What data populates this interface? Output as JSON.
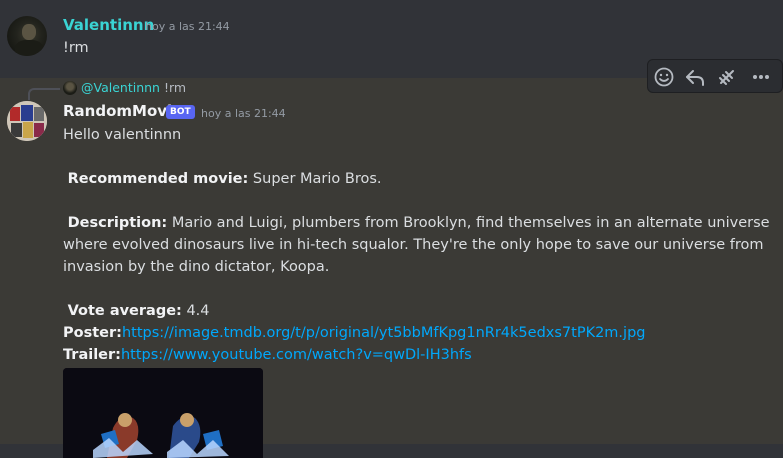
{
  "user_message": {
    "author": "Valentinnn",
    "timestamp": "hoy a las 21:44",
    "text": "!rm"
  },
  "bot_message": {
    "reply_preview": {
      "author": "@Valentinnn",
      "text": "!rm"
    },
    "author": "RandomMovie",
    "badge": "BOT",
    "timestamp": "hoy a las 21:44",
    "greeting": "Hello valentinnn",
    "recommended_label": "Recommended movie:",
    "recommended_value": "Super Mario Bros.",
    "description_label": "Description:",
    "description_lines": [
      "Mario and Luigi, plumbers from Brooklyn, find themselves in an alternate universe",
      "where evolved dinosaurs live in hi-tech squalor. They're the only hope to save our universe from",
      "invasion by the dino dictator, Koopa."
    ],
    "vote_label": "Vote average:",
    "vote_value": "4.4",
    "poster_label": "Poster:",
    "poster_url": "https://image.tmdb.org/t/p/original/yt5bbMfKpg1nRr4k5edxs7tPK2m.jpg",
    "trailer_label": "Trailer:",
    "trailer_url": "https://www.youtube.com/watch?v=qwDl-IH3hfs"
  },
  "toolbar_icons": [
    "add-reaction-icon",
    "reply-icon",
    "create-thread-icon",
    "more-icon"
  ],
  "colors": {
    "background": "#313338",
    "hover_background": "#3b3a36",
    "user_name": "#3ad4d4",
    "link": "#00a8fc",
    "bot_badge": "#5865f2"
  }
}
